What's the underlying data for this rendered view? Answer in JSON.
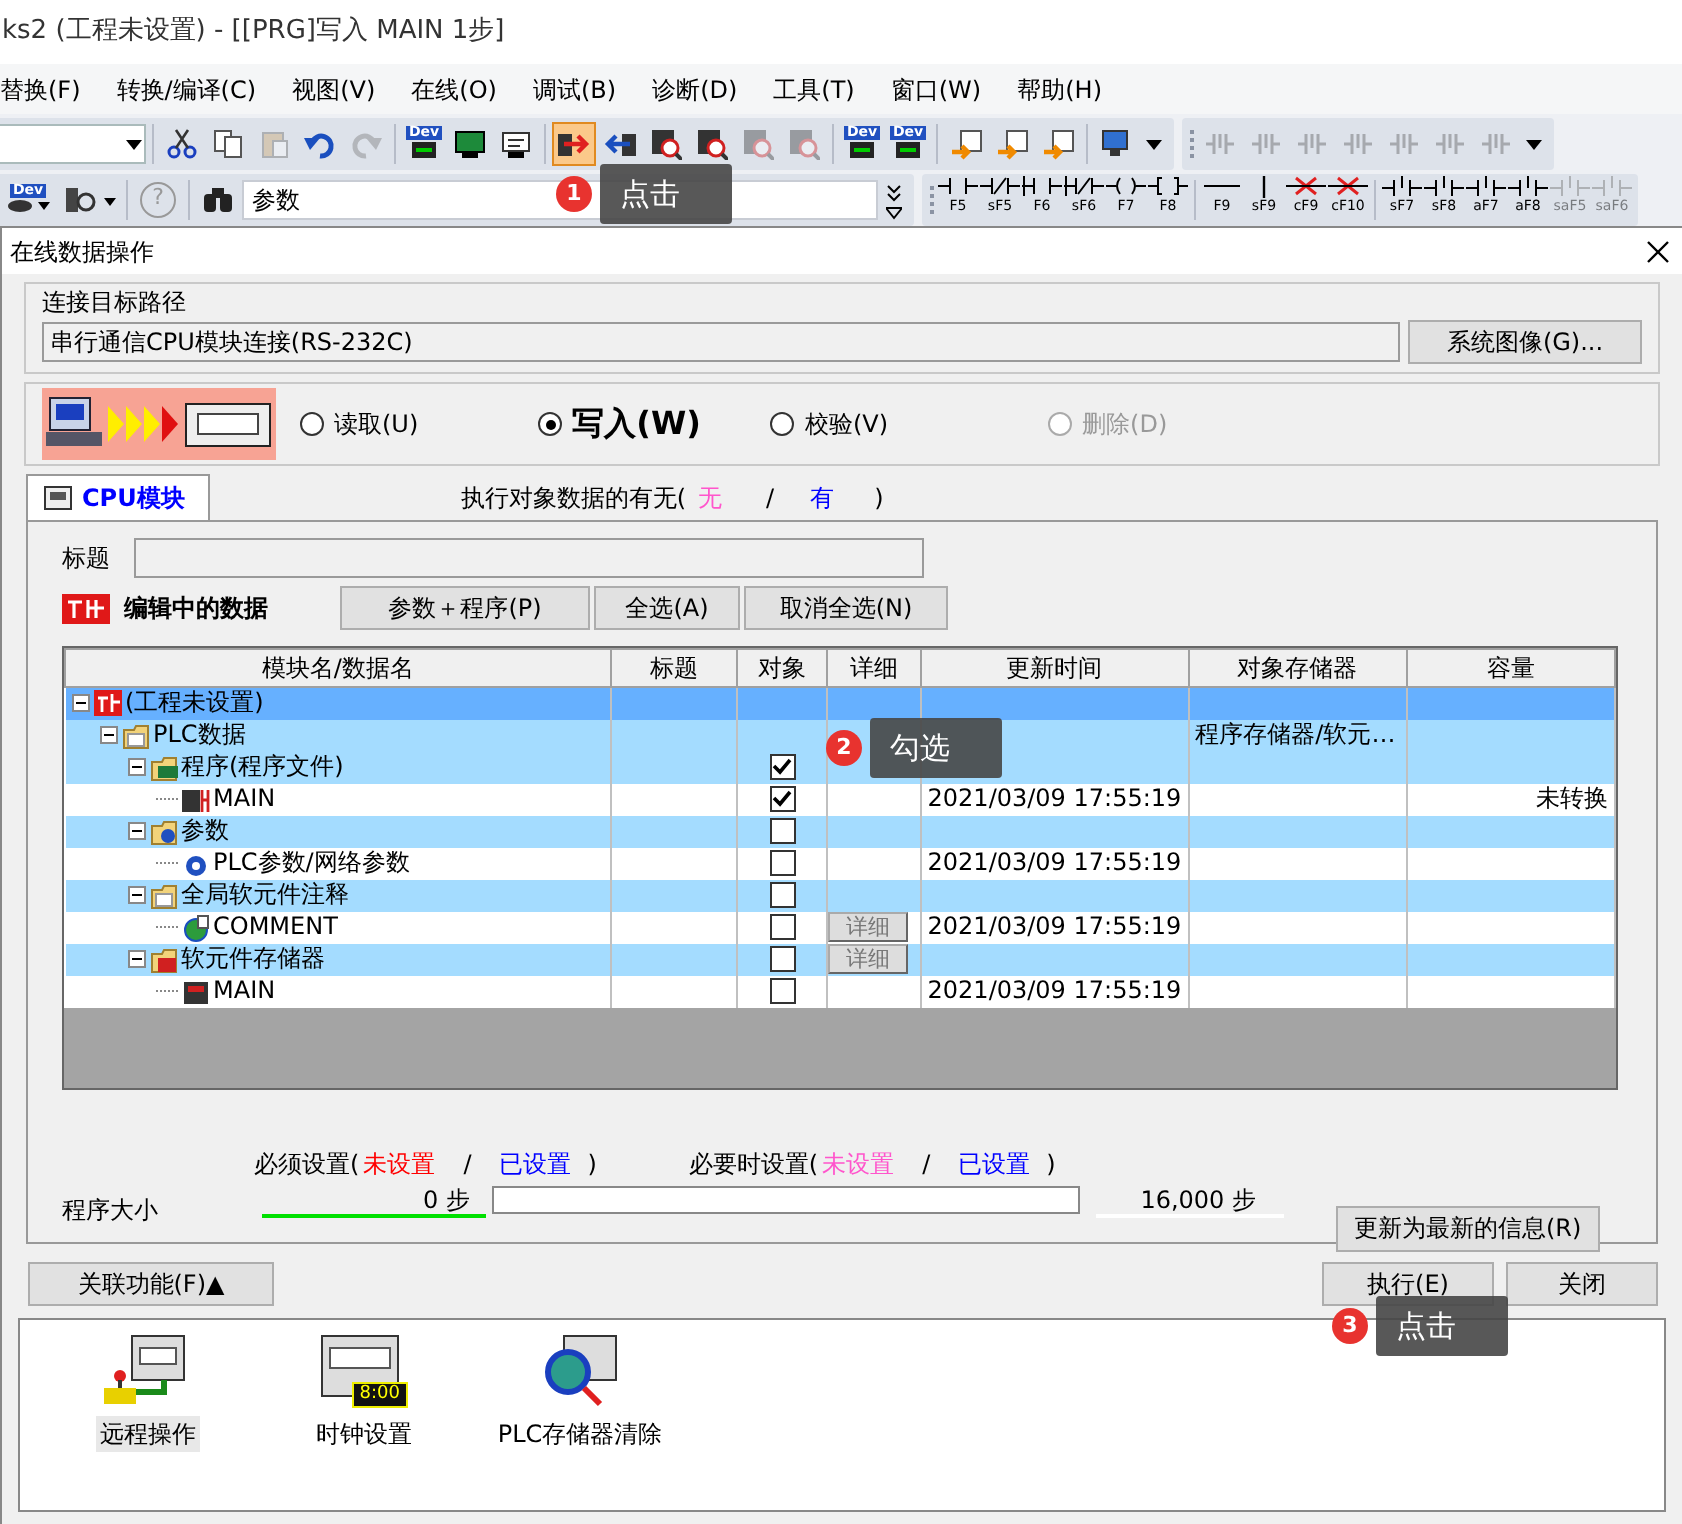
{
  "window": {
    "title": "ks2 (工程未设置) - [[PRG]写入 MAIN 1步]"
  },
  "menu": [
    "替换(F)",
    "转换/编译(C)",
    "视图(V)",
    "在线(O)",
    "调试(B)",
    "诊断(D)",
    "工具(T)",
    "窗口(W)",
    "帮助(H)"
  ],
  "toolbar1": [
    [
      {
        "kind": "scissors",
        "disabled": false,
        "pressed": false
      },
      {
        "kind": "copy",
        "disabled": false,
        "pressed": false
      },
      {
        "kind": "paste",
        "disabled": true,
        "pressed": false
      },
      {
        "kind": "undo",
        "disabled": false,
        "pressed": false
      },
      {
        "kind": "redo",
        "disabled": true,
        "pressed": false
      }
    ],
    [
      {
        "kind": "dev",
        "label": "Dev",
        "disabled": false,
        "pressed": false
      },
      {
        "kind": "terminal",
        "disabled": false,
        "pressed": false
      },
      {
        "kind": "doc",
        "disabled": false,
        "pressed": false
      }
    ],
    [
      {
        "kind": "write",
        "disabled": false,
        "pressed": true
      },
      {
        "kind": "read",
        "disabled": false,
        "pressed": false
      },
      {
        "kind": "verify",
        "disabled": false,
        "pressed": false
      },
      {
        "kind": "verify",
        "disabled": false,
        "pressed": false
      },
      {
        "kind": "verify",
        "disabled": true,
        "pressed": false
      },
      {
        "kind": "verify",
        "disabled": true,
        "pressed": false
      }
    ],
    [
      {
        "kind": "dev",
        "label": "Dev",
        "disabled": false,
        "pressed": false
      },
      {
        "kind": "dev",
        "label": "Dev",
        "disabled": false,
        "pressed": false
      }
    ],
    [
      {
        "kind": "docarrow",
        "disabled": false,
        "pressed": false
      },
      {
        "kind": "docarrow",
        "disabled": false,
        "pressed": false
      },
      {
        "kind": "docarrow",
        "disabled": false,
        "pressed": false
      }
    ],
    [
      {
        "kind": "monitor",
        "disabled": false,
        "pressed": false
      }
    ]
  ],
  "toolbar1b": [
    {
      "kind": "ladder",
      "disabled": true
    },
    {
      "kind": "ladder",
      "disabled": true
    },
    {
      "kind": "ladder",
      "disabled": true
    },
    {
      "kind": "ladder",
      "disabled": true
    },
    {
      "kind": "ladder",
      "disabled": true
    },
    {
      "kind": "ladder",
      "disabled": true
    },
    {
      "kind": "ladder",
      "disabled": true
    }
  ],
  "toolbar2": {
    "dev_label": "Dev",
    "help_label": "?",
    "search_value": "参数",
    "keys": [
      {
        "kind": "contact",
        "label": "F5",
        "disabled": false
      },
      {
        "kind": "nc",
        "label": "sF5",
        "disabled": false
      },
      {
        "kind": "parallel",
        "label": "F6",
        "disabled": false
      },
      {
        "kind": "parallelnc",
        "label": "sF6",
        "disabled": false
      },
      {
        "kind": "coil",
        "label": "F7",
        "disabled": false
      },
      {
        "kind": "func",
        "label": "F8",
        "disabled": false
      },
      {
        "kind": "hline",
        "label": "F9",
        "disabled": false
      },
      {
        "kind": "vline",
        "label": "sF9",
        "disabled": false
      },
      {
        "kind": "delete",
        "label": "cF9",
        "disabled": false
      },
      {
        "kind": "delete",
        "label": "cF10",
        "disabled": false
      },
      {
        "kind": "pulse",
        "label": "sF7",
        "disabled": false
      },
      {
        "kind": "pulse",
        "label": "sF8",
        "disabled": false
      },
      {
        "kind": "pulse",
        "label": "aF7",
        "disabled": false
      },
      {
        "kind": "pulse",
        "label": "aF8",
        "disabled": false
      },
      {
        "kind": "pulse",
        "label": "saF5",
        "disabled": true
      },
      {
        "kind": "pulse",
        "label": "saF6",
        "disabled": true
      }
    ]
  },
  "dialog": {
    "title": "在线数据操作",
    "connection": {
      "legend": "连接目标路径",
      "value": "串行通信CPU模块连接(RS-232C)",
      "button": "系统图像(G)..."
    },
    "modes": [
      {
        "label": "读取(U)",
        "selected": false,
        "disabled": false
      },
      {
        "label": "写入(W)",
        "selected": true,
        "disabled": false
      },
      {
        "label": "校验(V)",
        "selected": false,
        "disabled": false
      },
      {
        "label": "删除(D)",
        "selected": false,
        "disabled": true
      }
    ],
    "tab": {
      "label": "CPU模块",
      "selected": true
    },
    "presence": {
      "label": "执行对象数据的有无(",
      "none": {
        "text": "无",
        "color": "#ff55cc"
      },
      "sep": "/",
      "has": {
        "text": "有",
        "color": "#0000ff"
      },
      "close": ")"
    },
    "title_label": "标题",
    "editing_label": "编辑中的数据",
    "buttons": [
      "参数＋程序(P)",
      "全选(A)",
      "取消全选(N)"
    ],
    "table": {
      "columns": [
        "模块名/数据名",
        "标题",
        "对象",
        "详细",
        "更新时间",
        "对象存储器",
        "容量"
      ],
      "rows": [
        {
          "name": "(工程未设置)",
          "kind": "project",
          "selected": true,
          "expanded": true,
          "children": [
            {
              "name": "PLC数据",
              "kind": "folder",
              "selected": false,
              "expanded": true,
              "storage": "程序存储器/软元…",
              "children": [
                {
                  "name": "程序(程序文件)",
                  "kind": "program",
                  "selected": false,
                  "expanded": true,
                  "checked": true,
                  "children": [
                    {
                      "name": "MAIN",
                      "kind": "ladder",
                      "selected": false,
                      "checked": true,
                      "time": "2021/03/09 17:55:19",
                      "capacity": "未转换"
                    }
                  ]
                },
                {
                  "name": "参数",
                  "kind": "param",
                  "selected": false,
                  "expanded": true,
                  "checked": false,
                  "children": [
                    {
                      "name": "PLC参数/网络参数",
                      "kind": "paramfile",
                      "selected": false,
                      "checked": false,
                      "time": "2021/03/09 17:55:19"
                    }
                  ]
                },
                {
                  "name": "全局软元件注释",
                  "kind": "folder",
                  "selected": false,
                  "expanded": true,
                  "checked": false,
                  "children": [
                    {
                      "name": "COMMENT",
                      "kind": "comment",
                      "selected": false,
                      "checked": false,
                      "detail": "详细",
                      "time": "2021/03/09 17:55:19"
                    }
                  ]
                },
                {
                  "name": "软元件存储器",
                  "kind": "device",
                  "selected": false,
                  "expanded": true,
                  "checked": false,
                  "detail": "详细",
                  "children": [
                    {
                      "name": "MAIN",
                      "kind": "devfile",
                      "selected": false,
                      "checked": false,
                      "time": "2021/03/09 17:55:19"
                    }
                  ]
                }
              ]
            }
          ]
        }
      ]
    },
    "legend": [
      {
        "label": "必须设置(",
        "unset": {
          "text": "未设置",
          "color": "#ff0000"
        },
        "sep": "/",
        "set": {
          "text": "已设置",
          "color": "#0000ff"
        },
        "close": ")"
      },
      {
        "label": "必要时设置(",
        "unset": {
          "text": "未设置",
          "color": "#ff55cc"
        },
        "sep": "/",
        "set": {
          "text": "已设置",
          "color": "#0000ff"
        },
        "close": ")"
      }
    ],
    "program_size": {
      "label": "程序大小",
      "used": "0 步",
      "level": 0,
      "capacity": "16,000 步"
    },
    "refresh_button": "更新为最新的信息(R)",
    "related_button": "关联功能(F)▲",
    "execute_button": "执行(E)",
    "close_button": "关闭",
    "functions": [
      {
        "label": "远程操作",
        "kind": "remote",
        "selected": true
      },
      {
        "label": "时钟设置",
        "kind": "clock",
        "clock": "8:00",
        "selected": false
      },
      {
        "label": "PLC存储器清除",
        "kind": "clear",
        "selected": false
      }
    ]
  },
  "callouts": [
    {
      "number": "1",
      "text": "点击"
    },
    {
      "number": "2",
      "text": "勾选"
    },
    {
      "number": "3",
      "text": "点击"
    }
  ]
}
